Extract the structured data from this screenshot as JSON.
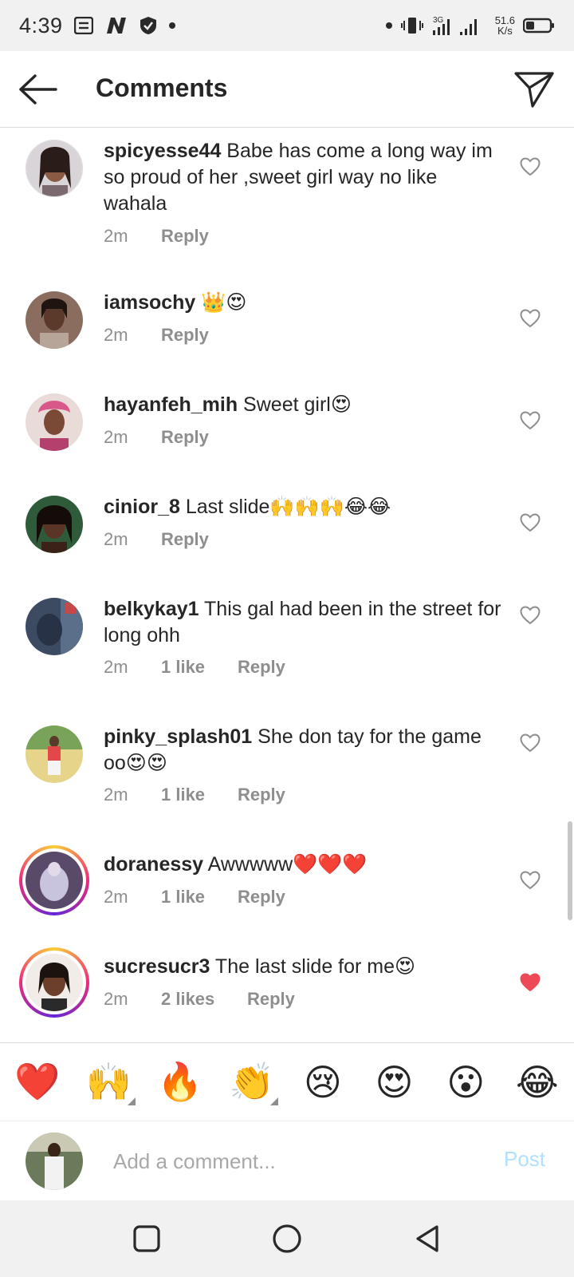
{
  "status_bar": {
    "time": "4:39",
    "speed_value": "51.6",
    "speed_unit": "K/s",
    "network": "3G",
    "icons": [
      "notes-icon",
      "n-app-icon",
      "shield-icon",
      "dot-icon",
      "vibrate-icon",
      "signal-icon",
      "battery-icon"
    ]
  },
  "header": {
    "title": "Comments",
    "back_icon": "back-arrow-icon",
    "share_icon": "paper-plane-icon"
  },
  "comments": [
    {
      "username": "spicyesse44",
      "text": " Babe has come a long way im so proud of her ,sweet girl way no like wahala",
      "time": "2m",
      "likes": "",
      "reply": "Reply",
      "liked": false
    },
    {
      "username": "iamsochy",
      "text": " 👑😍",
      "time": "2m",
      "likes": "",
      "reply": "Reply",
      "liked": false
    },
    {
      "username": "hayanfeh_mih",
      "text": " Sweet girl😍",
      "time": "2m",
      "likes": "",
      "reply": "Reply",
      "liked": false
    },
    {
      "username": "cinior_8",
      "text": " Last slide🙌🙌🙌😂😂",
      "time": "2m",
      "likes": "",
      "reply": "Reply",
      "liked": false
    },
    {
      "username": "belkykay1",
      "text": " This gal had been in the street for long ohh",
      "time": "2m",
      "likes": "1 like",
      "reply": "Reply",
      "liked": false
    },
    {
      "username": "pinky_splash01",
      "text": " She don tay for the game oo😍😍",
      "time": "2m",
      "likes": "1 like",
      "reply": "Reply",
      "liked": false
    },
    {
      "username": "doranessy",
      "text": " Awwwww❤️❤️❤️",
      "time": "2m",
      "likes": "1 like",
      "reply": "Reply",
      "liked": false
    },
    {
      "username": "sucresucr3",
      "text": " The last slide for me😍",
      "time": "2m",
      "likes": "2 likes",
      "reply": "Reply",
      "liked": true
    }
  ],
  "emoji_bar": [
    "❤️",
    "🙌",
    "🔥",
    "👏",
    "😢",
    "😍",
    "😮",
    "😂"
  ],
  "composer": {
    "placeholder": "Add a comment...",
    "post_label": "Post"
  },
  "colors": {
    "text": "#262626",
    "meta": "#8e8e8e",
    "like_red": "#ed4956",
    "post_blue_disabled": "#b2dffc"
  }
}
